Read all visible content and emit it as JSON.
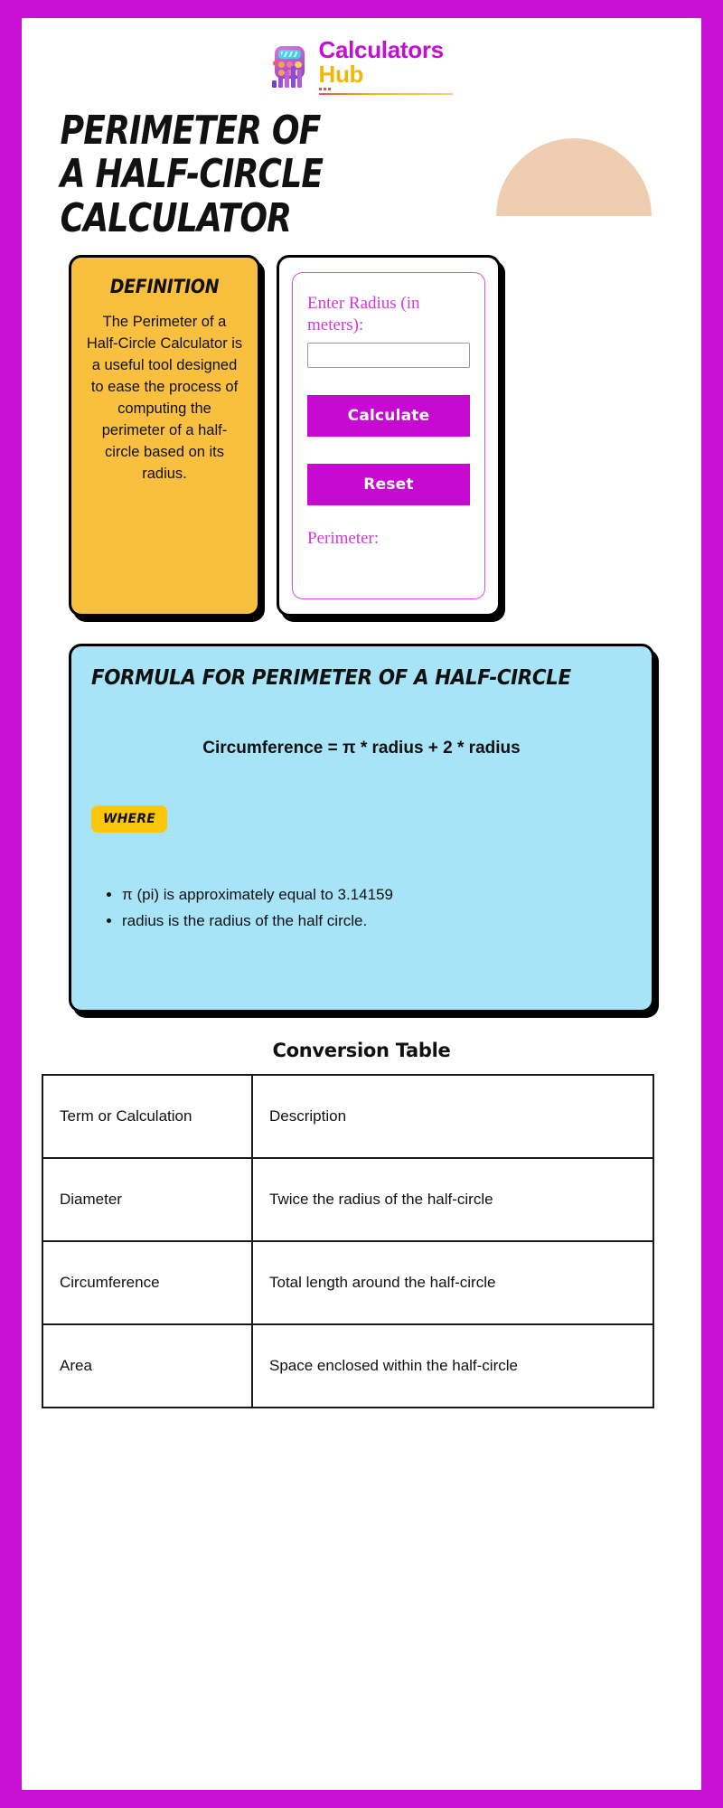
{
  "brand": {
    "line1": "Calculators",
    "line2": "Hub",
    "logo_icon": "calculator-bars-logo"
  },
  "hero": {
    "title": "Perimeter of a Half-Circle Calculator",
    "decoration": "half-circle-shape",
    "decoration_color": "#eecdb0"
  },
  "definition": {
    "heading": "Definition",
    "body": "The Perimeter of a Half-Circle Calculator is a useful tool designed to ease the process of computing the perimeter of a half-circle based on its radius."
  },
  "calculator": {
    "input_label": "Enter Radius (in meters):",
    "input_value": "",
    "input_placeholder": "",
    "calculate_label": "Calculate",
    "reset_label": "Reset",
    "result_label": "Perimeter:",
    "accent_color": "#c70ad1",
    "border_color": "#e04ae6"
  },
  "formula": {
    "heading": "Formula for Perimeter of a Half-Circle",
    "equation": "Circumference = π * radius + 2 * radius",
    "where_badge": "Where",
    "bullets": [
      "π (pi) is approximately equal to 3.14159",
      "radius is the radius of the half circle."
    ],
    "background_color": "#a8e4f8"
  },
  "conversion_table": {
    "title": "Conversion Table",
    "headers": [
      "Term or Calculation",
      "Description"
    ],
    "rows": [
      [
        "Diameter",
        "Twice the radius of the half-circle"
      ],
      [
        "Circumference",
        "Total length around the half-circle"
      ],
      [
        "Area",
        "Space enclosed within the half-circle"
      ]
    ]
  },
  "theme": {
    "frame_color": "#c710d4",
    "definition_bg": "#f9bf3e",
    "badge_bg": "#fcc60b"
  }
}
